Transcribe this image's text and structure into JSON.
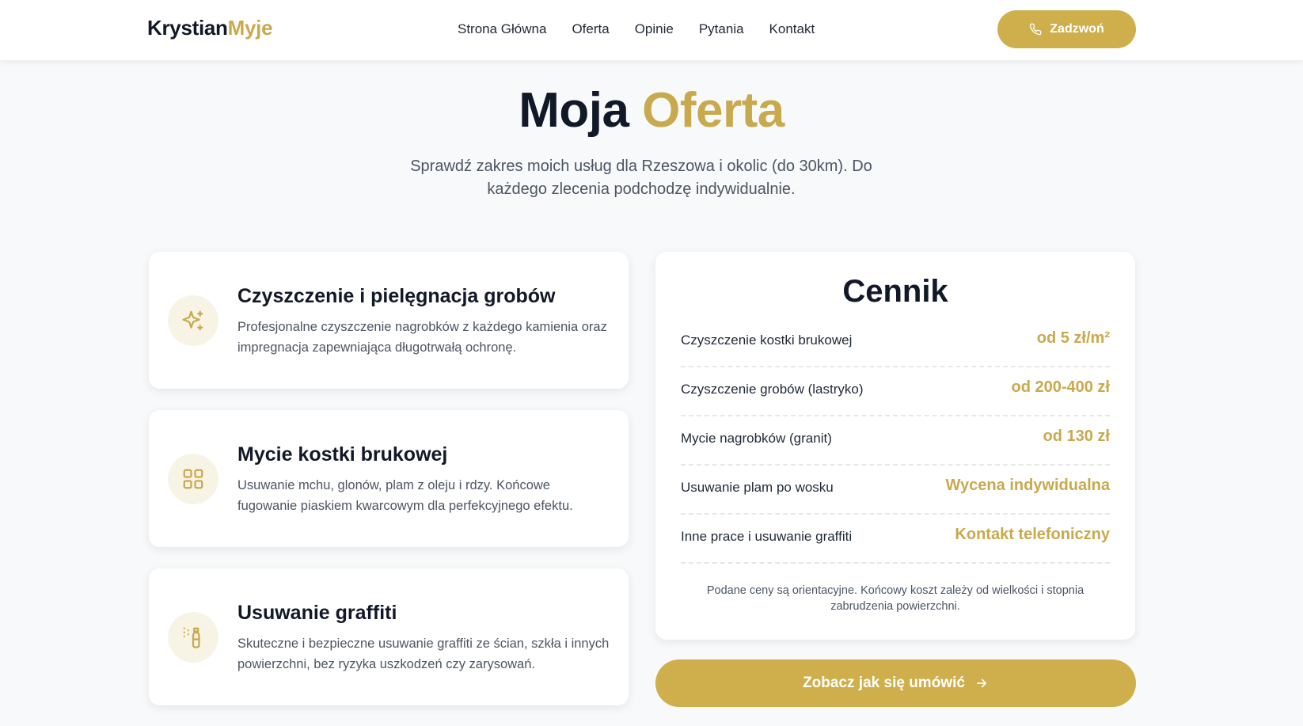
{
  "header": {
    "logo_dark": "Krystian",
    "logo_gold": "Myje",
    "nav": [
      "Strona Główna",
      "Oferta",
      "Opinie",
      "Pytania",
      "Kontakt"
    ],
    "call_label": "Zadzwoń"
  },
  "hero": {
    "title_dark": "Moja",
    "title_gold": "Oferta",
    "subtitle": "Sprawdź zakres moich usług dla Rzeszowa i okolic (do 30km). Do każdego zlecenia podchodzę indywidualnie."
  },
  "services": [
    {
      "icon": "sparkles-icon",
      "title": "Czyszczenie i pielęgnacja grobów",
      "description": "Profesjonalne czyszczenie nagrobków z każdego kamienia oraz impregnacja zapewniająca długotrwałą ochronę."
    },
    {
      "icon": "grid-icon",
      "title": "Mycie kostki brukowej",
      "description": "Usuwanie mchu, glonów, plam z oleju i rdzy. Końcowe fugowanie piaskiem kwarcowym dla perfekcyjnego efektu."
    },
    {
      "icon": "spray-can-icon",
      "title": "Usuwanie graffiti",
      "description": "Skuteczne i bezpieczne usuwanie graffiti ze ścian, szkła i innych powierzchni, bez ryzyka uszkodzeń czy zarysowań."
    }
  ],
  "pricing": {
    "title": "Cennik",
    "rows": [
      {
        "name": "Czyszczenie kostki brukowej",
        "price": "od 5 zł/m²"
      },
      {
        "name": "Czyszczenie grobów (lastryko)",
        "price": "od 200-400 zł"
      },
      {
        "name": "Mycie nagrobków (granit)",
        "price": "od 130 zł"
      },
      {
        "name": "Usuwanie plam po wosku",
        "price": "Wycena indywidualna"
      },
      {
        "name": "Inne prace i usuwanie graffiti",
        "price": "Kontakt telefoniczny"
      }
    ],
    "note": "Podane ceny są orientacyjne. Końcowy koszt zależy od wielkości i stopnia zabrudzenia powierzchni."
  },
  "cta": {
    "label": "Zobacz jak się umówić"
  },
  "colors": {
    "accent": "#cfae4c",
    "accent_text": "#c9a94d",
    "dark": "#111827"
  }
}
